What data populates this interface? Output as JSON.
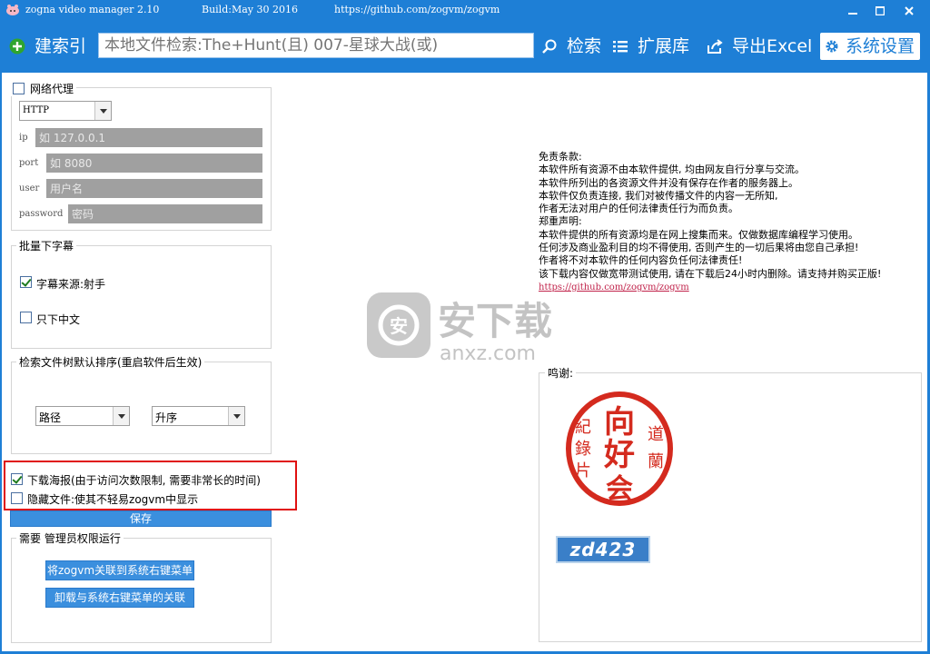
{
  "window": {
    "app_name": "zogna video manager 2.10",
    "build": "Build:May 30 2016",
    "url": "https://github.com/zogvm/zogvm"
  },
  "toolbar": {
    "index_label": "建索引",
    "search_placeholder": "本地文件检索:The+Hunt(且) 007-星球大战(或)",
    "search_label": "检索",
    "extensions_label": "扩展库",
    "export_label": "导出Excel",
    "settings_label": "系统设置"
  },
  "proxy": {
    "title": "网络代理",
    "checked": false,
    "type_selected": "HTTP",
    "ip_label": "ip",
    "ip_placeholder": "如 127.0.0.1",
    "port_label": "port",
    "port_placeholder": "如 8080",
    "user_label": "user",
    "user_placeholder": "用户名",
    "password_label": "password",
    "password_placeholder": "密码"
  },
  "subtitles": {
    "title": "批量下字幕",
    "source_label": "字幕来源:射手",
    "source_checked": true,
    "chinese_only_label": "只下中文",
    "chinese_only_checked": false
  },
  "sort": {
    "title": "检索文件树默认排序(重启软件后生效)",
    "field_selected": "路径",
    "order_selected": "升序"
  },
  "options": {
    "download_poster_label": "下载海报(由于访问次数限制, 需要非常长的时间)",
    "download_poster_checked": true,
    "hide_files_label": "隐藏文件:使其不轻易zogvm中显示",
    "hide_files_checked": false,
    "save_label": "保存"
  },
  "admin": {
    "title": "需要 管理员权限运行",
    "associate_label": "将zogvm关联到系统右键菜单",
    "unassociate_label": "卸载与系统右键菜单的关联"
  },
  "disclaimer": {
    "lines": [
      "免责条款:",
      "本软件所有资源不由本软件提供, 均由网友自行分享与交流。",
      "本软件所列出的各资源文件并没有保存在作者的服务器上。",
      "本软件仅负责连接, 我们对被传播文件的内容一无所知,",
      "作者无法对用户的任何法律责任行为而负责。",
      "郑重声明:",
      "本软件提供的所有资源均是在网上搜集而来。仅做数据库编程学习使用。",
      "任何涉及商业盈利目的均不得使用, 否则产生的一切后果将由您自己承担!",
      "作者将不对本软件的任何内容负任何法律责任!",
      "该下载内容仅做宽带测试使用, 请在下载后24小时内删除。请支持并购买正版!"
    ],
    "link": "https://github.com/zogvm/zogvm"
  },
  "thanks": {
    "title": "鸣谢:",
    "seal_chars": [
      "向",
      "好",
      "会",
      "紀",
      "錄",
      "片",
      "道",
      "蘭"
    ],
    "badge_text": "zd423"
  },
  "watermark": {
    "main": "安下载",
    "sub": "anxz.com"
  },
  "colors": {
    "titlebar": "#1e7fd6",
    "button_blue": "#3b8fde",
    "highlight_red": "#e01010",
    "seal_red": "#d42a1e"
  }
}
